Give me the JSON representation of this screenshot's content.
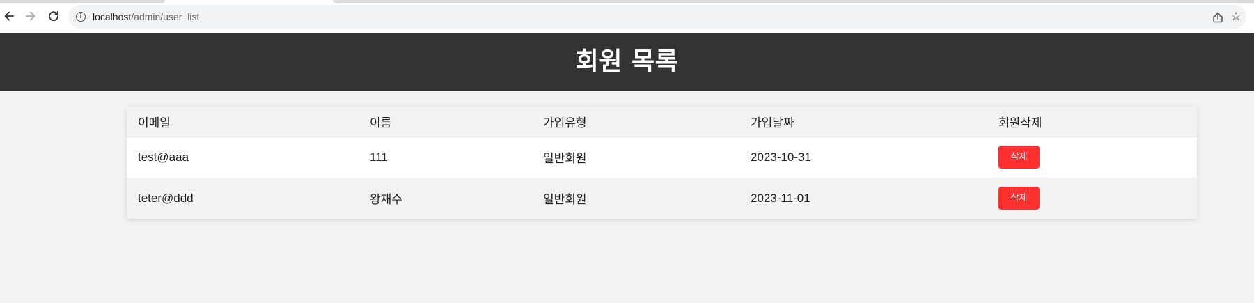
{
  "browser": {
    "url_host": "localhost",
    "url_path": "/admin/user_list"
  },
  "header": {
    "title": "회원 목록"
  },
  "table": {
    "columns": [
      "이메일",
      "이름",
      "가입유형",
      "가입날짜",
      "회원삭제"
    ],
    "rows": [
      {
        "email": "test@aaa",
        "name": "111",
        "type": "일반회원",
        "date": "2023-10-31",
        "action": "삭제"
      },
      {
        "email": "teter@ddd",
        "name": "왕재수",
        "type": "일반회원",
        "date": "2023-11-01",
        "action": "삭제"
      }
    ]
  },
  "colors": {
    "header_bg": "#333333",
    "page_bg": "#f3f3f3",
    "delete_button": "#ff3030"
  },
  "icons": {
    "back": "back-arrow-icon",
    "forward": "forward-arrow-icon",
    "reload": "reload-icon",
    "info": "info-icon",
    "share": "share-icon",
    "bookmark": "star-icon"
  }
}
